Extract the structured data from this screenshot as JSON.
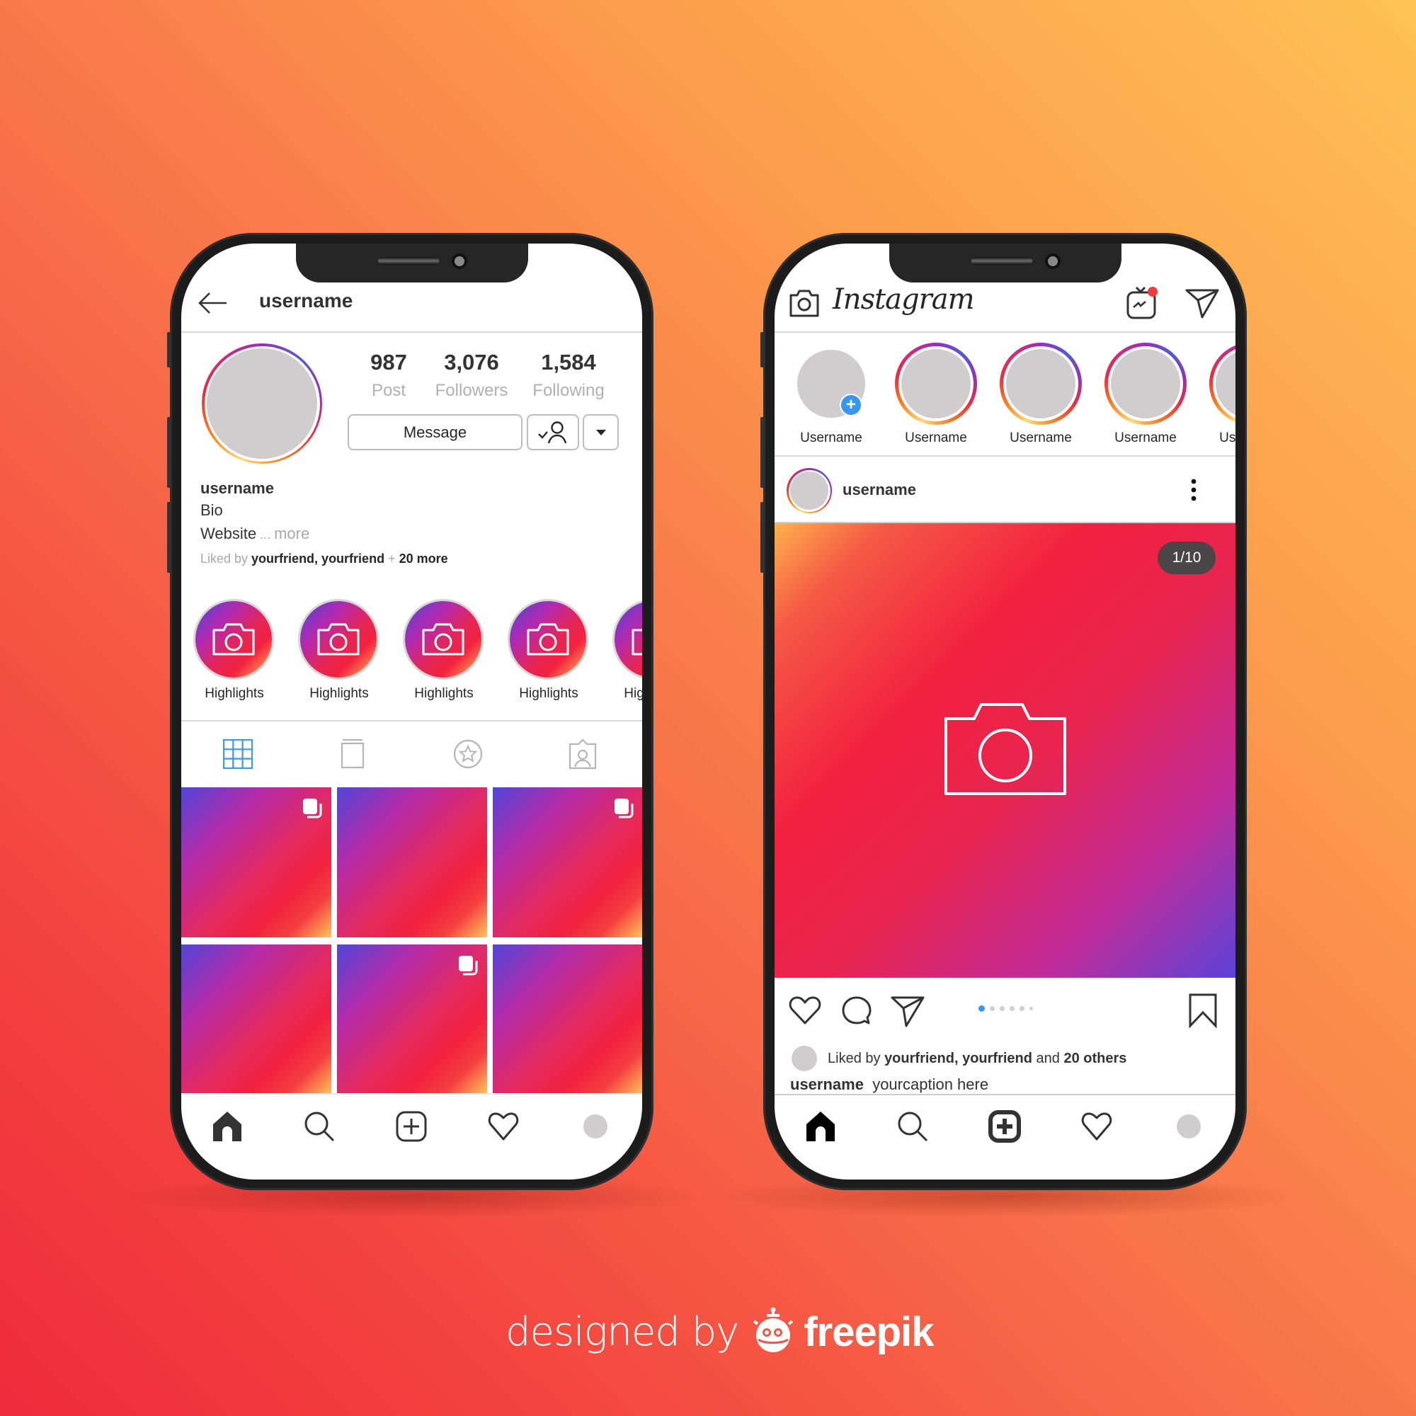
{
  "profile_phone": {
    "header": {
      "back_icon": "arrow-left-icon",
      "username": "username"
    },
    "stats": [
      {
        "value": "987",
        "label": "Post"
      },
      {
        "value": "3,076",
        "label": "Followers"
      },
      {
        "value": "1,584",
        "label": "Following"
      }
    ],
    "buttons": {
      "message": "Message",
      "following_icon": "user-check-icon",
      "dropdown_icon": "caret-down-icon"
    },
    "bio": {
      "username": "username",
      "bio": "Bio",
      "website": "Website",
      "ellipsis": " ... ",
      "more": "more",
      "liked_by_prefix": "Liked by ",
      "liked_by_names": "yourfriend, yourfriend",
      "liked_by_plus": " + ",
      "liked_by_more": "20 more"
    },
    "highlights": [
      {
        "label": "Highlights"
      },
      {
        "label": "Highlights"
      },
      {
        "label": "Highlights"
      },
      {
        "label": "Highlights"
      },
      {
        "label": "Highlights"
      }
    ],
    "tabs": [
      {
        "icon": "grid-icon",
        "active": true
      },
      {
        "icon": "igtv-tab-icon",
        "active": false
      },
      {
        "icon": "star-circle-icon",
        "active": false
      },
      {
        "icon": "tagged-user-icon",
        "active": false
      }
    ],
    "grid": [
      {
        "multi": true
      },
      {
        "multi": false
      },
      {
        "multi": true
      },
      {
        "multi": false
      },
      {
        "multi": true
      },
      {
        "multi": false
      }
    ],
    "bottom_nav": [
      "home-icon",
      "search-icon",
      "add-post-icon",
      "heart-icon",
      "profile-avatar"
    ]
  },
  "feed_phone": {
    "header": {
      "camera_icon": "camera-icon",
      "logo": "Instagram",
      "igtv_icon": "igtv-icon",
      "direct_icon": "paper-plane-icon"
    },
    "stories": [
      {
        "label": "Username",
        "own": true
      },
      {
        "label": "Username",
        "own": false
      },
      {
        "label": "Username",
        "own": false
      },
      {
        "label": "Username",
        "own": false
      },
      {
        "label": "Username",
        "own": false
      }
    ],
    "post": {
      "username": "username",
      "more_icon": "more-vertical-icon",
      "counter": "1/10",
      "carousel_dots": 6,
      "carousel_active": 1,
      "liked_by_prefix": "Liked by ",
      "liked_by_names": "yourfriend, yourfriend",
      "liked_by_and": " and ",
      "liked_by_count": "20 others",
      "caption_user": "username",
      "caption_text": "yourcaption here"
    },
    "bottom_nav": [
      "home-icon",
      "search-icon",
      "add-post-icon",
      "heart-icon",
      "profile-avatar"
    ]
  },
  "credit": {
    "designed_by": "designed by",
    "brand": "freepik"
  },
  "colors": {
    "accent_blue": "#3897f0",
    "text_dark": "#262626",
    "text_muted": "#a8a8a8",
    "placeholder_gray": "#cfcdcd"
  }
}
